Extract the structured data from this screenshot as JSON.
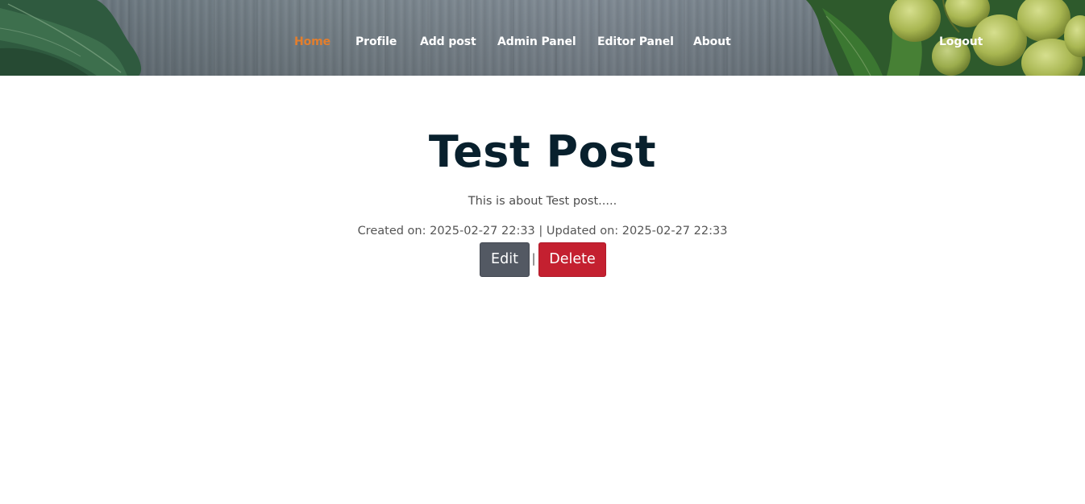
{
  "nav": {
    "home": "Home",
    "profile": "Profile",
    "add_post": "Add post",
    "admin_panel": "Admin Panel",
    "editor_panel": "Editor Panel",
    "about": "About",
    "logout": "Logout",
    "active_item": "Home"
  },
  "post": {
    "title": "Test Post",
    "body": "This is about Test post.....",
    "meta": "Created on: 2025-02-27 22:33 | Updated on: 2025-02-27 22:33"
  },
  "actions": {
    "edit_label": "Edit",
    "separator": "|",
    "delete_label": "Delete"
  },
  "colors": {
    "nav_active": "#e47e2c",
    "nav_text": "#ffffff",
    "title": "#08202d",
    "edit_button": "#535963",
    "delete_button": "#c42030"
  },
  "header_image": {
    "icons": [
      "leaf-icon",
      "grapes-icon"
    ]
  }
}
